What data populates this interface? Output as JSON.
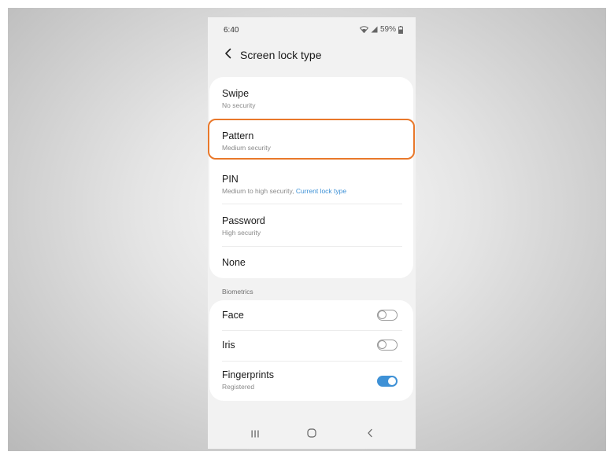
{
  "status_bar": {
    "time": "6:40",
    "battery": "59%"
  },
  "header": {
    "title": "Screen lock type"
  },
  "lock_types": [
    {
      "title": "Swipe",
      "subtitle": "No security"
    },
    {
      "title": "Pattern",
      "subtitle": "Medium security"
    },
    {
      "title": "PIN",
      "subtitle": "Medium to high security, ",
      "subtitle_accent": "Current lock type"
    },
    {
      "title": "Password",
      "subtitle": "High security"
    },
    {
      "title": "None"
    }
  ],
  "biometrics": {
    "section_label": "Biometrics",
    "items": [
      {
        "title": "Face",
        "enabled": false
      },
      {
        "title": "Iris",
        "enabled": false
      },
      {
        "title": "Fingerprints",
        "subtitle": "Registered",
        "enabled": true
      }
    ]
  },
  "colors": {
    "accent": "#3e91d6",
    "highlight": "#e9782a"
  },
  "icons": [
    "wifi-icon",
    "signal-icon",
    "battery-icon",
    "back-arrow-icon",
    "recent-apps-icon",
    "home-icon",
    "nav-back-icon"
  ]
}
